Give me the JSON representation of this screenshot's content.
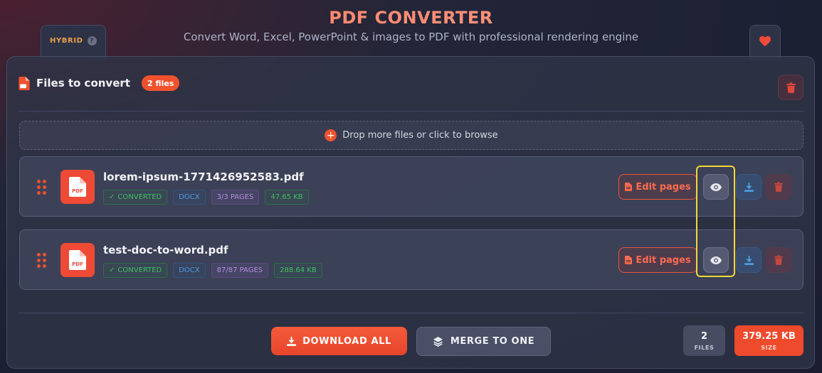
{
  "header": {
    "title": "PDF CONVERTER",
    "subtitle": "Convert Word, Excel, PowerPoint & images to PDF with professional rendering engine",
    "mode_tab": "HYBRID",
    "mode_help": "?"
  },
  "panel": {
    "title": "Files to convert",
    "count_badge": "2 files",
    "dropzone_text": "Drop more files or click to browse"
  },
  "files": [
    {
      "name": "lorem-ipsum-1771426952583.pdf",
      "status": "CONVERTED",
      "format": "DOCX",
      "pages": "3/3 PAGES",
      "size": "47.65 KB",
      "edit_label": "Edit pages"
    },
    {
      "name": "test-doc-to-word.pdf",
      "status": "CONVERTED",
      "format": "DOCX",
      "pages": "87/87 PAGES",
      "size": "288.64 KB",
      "edit_label": "Edit pages"
    }
  ],
  "thumb_label": "PDF",
  "footer": {
    "download_all": "DOWNLOAD ALL",
    "merge": "MERGE TO ONE",
    "files_count": "2",
    "files_label": "FILES",
    "total_size": "379.25 KB",
    "size_label": "SIZE"
  },
  "colors": {
    "accent": "#f0522e",
    "highlight": "#f5d737",
    "success": "#3fbf63",
    "info": "#4b9be0"
  },
  "icons": [
    "question-icon",
    "heart-icon",
    "file-pdf-icon",
    "trash-icon",
    "plus-circle-icon",
    "grip-icon",
    "eye-icon",
    "download-icon",
    "layers-icon",
    "check-icon"
  ]
}
